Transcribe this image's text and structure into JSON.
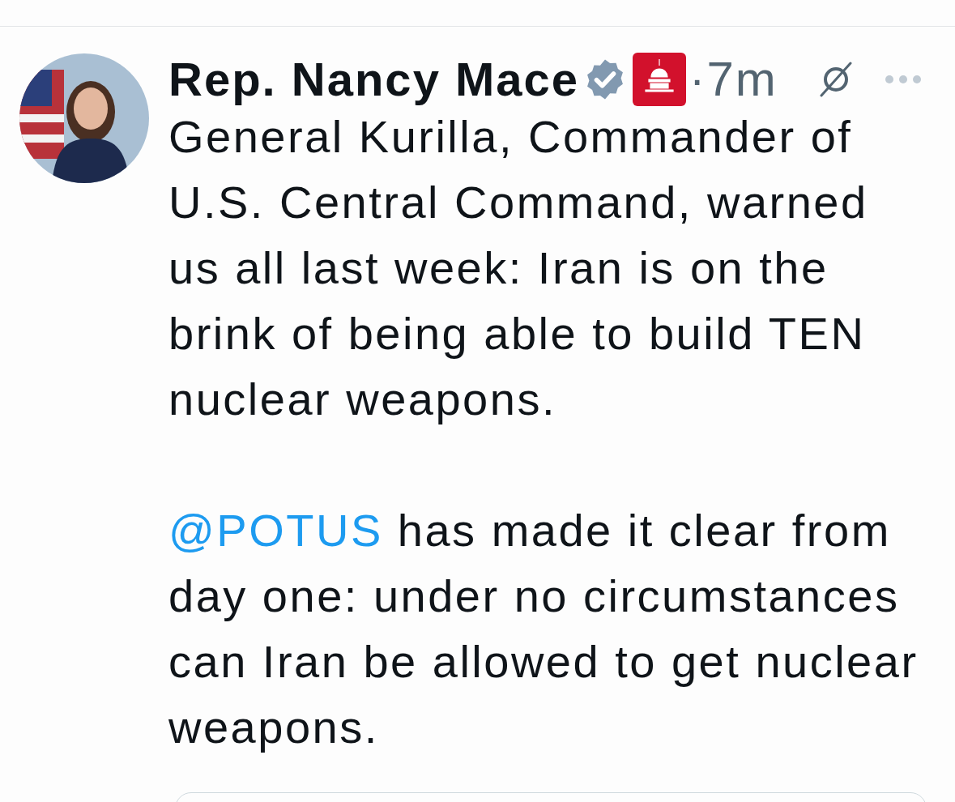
{
  "post": {
    "author": "Rep. Nancy Mace",
    "verified": true,
    "separator": "·",
    "time": "7m",
    "paragraphs": [
      {
        "lines": [
          "General Kurilla, Commander of",
          "U.S. Central Command, warned",
          "us all last week: Iran is on the",
          "brink of being able to build TEN",
          "nuclear weapons."
        ]
      },
      {
        "mention": "@POTUS",
        "lines": [
          " has made it clear from",
          "day one: under no circumstances",
          "can Iran be allowed to get nuclear",
          "weapons."
        ]
      }
    ]
  }
}
